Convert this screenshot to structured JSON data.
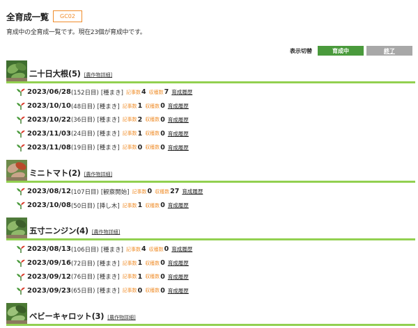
{
  "page": {
    "title": "全育成一覧",
    "code": "GC02",
    "description": "育成中の全育成一覧です。現在23個が育成中です。",
    "toggle_label": "表示切替",
    "btn_growing": "育成中",
    "btn_finished": "終了"
  },
  "labels": {
    "articles": "記事数",
    "harvest": "収穫数",
    "history": "育成履歴",
    "crop_detail": "[農作物詳細]"
  },
  "colors": {
    "accent_green": "#92d050",
    "button_green": "#4a9a3c",
    "button_gray": "#a8a8a8",
    "label_orange": "#f0902f"
  },
  "crops": [
    {
      "name": "二十日大根(5)",
      "rows": [
        {
          "date": "2023/06/28",
          "days": "(152日目)",
          "kind": "[種まき]",
          "articles": "4",
          "harvest": "7"
        },
        {
          "date": "2023/10/10",
          "days": "(48日目)",
          "kind": "[種まき]",
          "articles": "1",
          "harvest": "0"
        },
        {
          "date": "2023/10/22",
          "days": "(36日目)",
          "kind": "[種まき]",
          "articles": "2",
          "harvest": "0"
        },
        {
          "date": "2023/11/03",
          "days": "(24日目)",
          "kind": "[種まき]",
          "articles": "1",
          "harvest": "0"
        },
        {
          "date": "2023/11/08",
          "days": "(19日目)",
          "kind": "[種まき]",
          "articles": "0",
          "harvest": "0"
        }
      ]
    },
    {
      "name": "ミニトマト(2)",
      "rows": [
        {
          "date": "2023/08/12",
          "days": "(107日目)",
          "kind": "[観察開始]",
          "articles": "0",
          "harvest": "27"
        },
        {
          "date": "2023/10/08",
          "days": "(50日目)",
          "kind": "[挿し木]",
          "articles": "1",
          "harvest": "0"
        }
      ]
    },
    {
      "name": "五寸ニンジン(4)",
      "rows": [
        {
          "date": "2023/08/13",
          "days": "(106日目)",
          "kind": "[種まき]",
          "articles": "4",
          "harvest": "0"
        },
        {
          "date": "2023/09/16",
          "days": "(72日目)",
          "kind": "[種まき]",
          "articles": "1",
          "harvest": "0"
        },
        {
          "date": "2023/09/12",
          "days": "(76日目)",
          "kind": "[種まき]",
          "articles": "1",
          "harvest": "0"
        },
        {
          "date": "2023/09/23",
          "days": "(65日目)",
          "kind": "[種まき]",
          "articles": "0",
          "harvest": "0"
        }
      ]
    },
    {
      "name": "ベビーキャロット(3)",
      "rows": []
    }
  ]
}
